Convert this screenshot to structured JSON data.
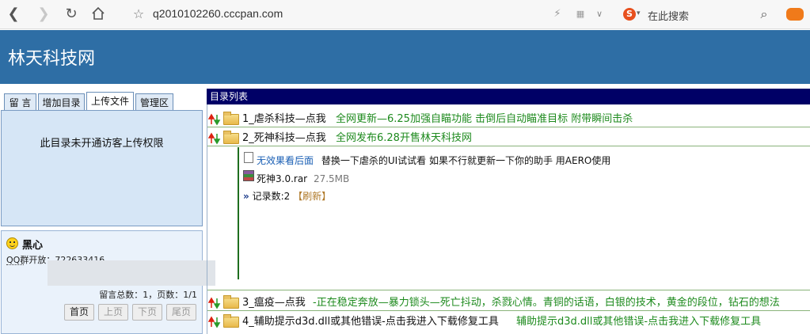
{
  "browser": {
    "url": "q2010102260.cccpan.com",
    "search_placeholder": "在此搜索"
  },
  "site": {
    "title": "林天科技网"
  },
  "left": {
    "tabs": [
      "留 言",
      "增加目录",
      "上传文件",
      "管理区"
    ],
    "active_tab": "上传文件",
    "upload_message": "此目录未开通访客上传权限",
    "message": {
      "user": "黑心",
      "qq": "QQ群开放：722633416",
      "stats": "留言总数：1，页数：1/1"
    },
    "pager": [
      "首页",
      "上页",
      "下页",
      "尾页"
    ]
  },
  "right": {
    "header": "目录列表",
    "dirs": [
      {
        "name": "1_虐杀科技—点我",
        "desc": "全网更新—6.25加强自瞄功能 击倒后自动瞄准目标 附带瞬间击杀"
      },
      {
        "name": "2_死神科技—点我",
        "desc": "全网发布6.28开售林天科技网"
      },
      {
        "name": "3_瘟疫—点我",
        "desc": "-正在稳定奔放—暴力锁头—死亡抖动，杀戮心情。青铜的话语，白银的技术，黄金的段位，钻石的想法"
      },
      {
        "name": "4_辅助提示d3d.dll或其他错误-点击我进入下载修复工具",
        "desc": "辅助提示d3d.dll或其他错误-点击我进入下载修复工具"
      }
    ],
    "files": [
      {
        "name": "无效果看后面",
        "note": "替换一下虐杀的UI试试看 如果不行就更新一下你的助手 用AERO使用"
      },
      {
        "name": "死神3.0.rar",
        "size": "27.5MB"
      }
    ],
    "record_count": "记录数:2",
    "refresh": "【刷新】"
  },
  "colors": {
    "header_bg": "#2e6ea5",
    "dir_head_bg": "#000066",
    "desc_green": "#1d8a1d"
  }
}
